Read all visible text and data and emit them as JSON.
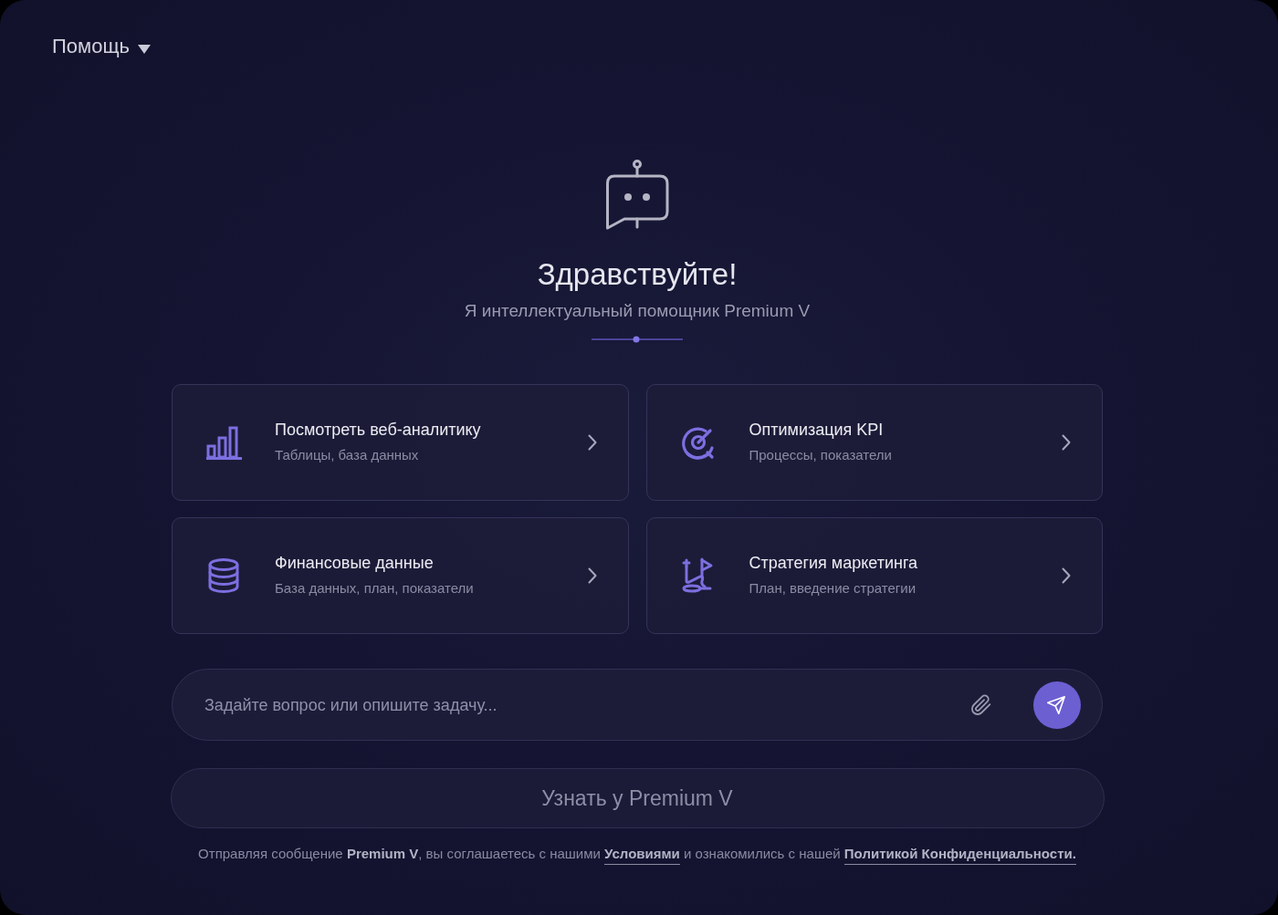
{
  "header": {
    "help_menu": {
      "label": "Помощь"
    }
  },
  "hero": {
    "title": "Здравствуйте!",
    "subtitle": "Я интеллектуальный помощник Premium V"
  },
  "suggestions": [
    {
      "title": "Посмотреть веб-аналитику",
      "subtitle": "Таблицы, база данных"
    },
    {
      "title": "Оптимизация KPI",
      "subtitle": "Процессы, показатели"
    },
    {
      "title": "Финансовые данные",
      "subtitle": "База данных, план, показатели"
    },
    {
      "title": "Стратегия маркетинга",
      "subtitle": "План, введение стратегии"
    }
  ],
  "composer": {
    "placeholder": "Задайте вопрос или опишите задачу..."
  },
  "ask_button": {
    "label": "Узнать у Premium V",
    "disabled": true
  },
  "legal_notice": {
    "parts": [
      {
        "kind": "text",
        "text": "Отправляя сообщение **Premium V**, вы соглашаетесь с нашими"
      },
      {
        "kind": "link",
        "text": "Условиями"
      },
      {
        "kind": "text",
        "text": "и ознакомились с нашей"
      },
      {
        "kind": "link",
        "text": "Политикой Конфиденциальности."
      }
    ]
  }
}
